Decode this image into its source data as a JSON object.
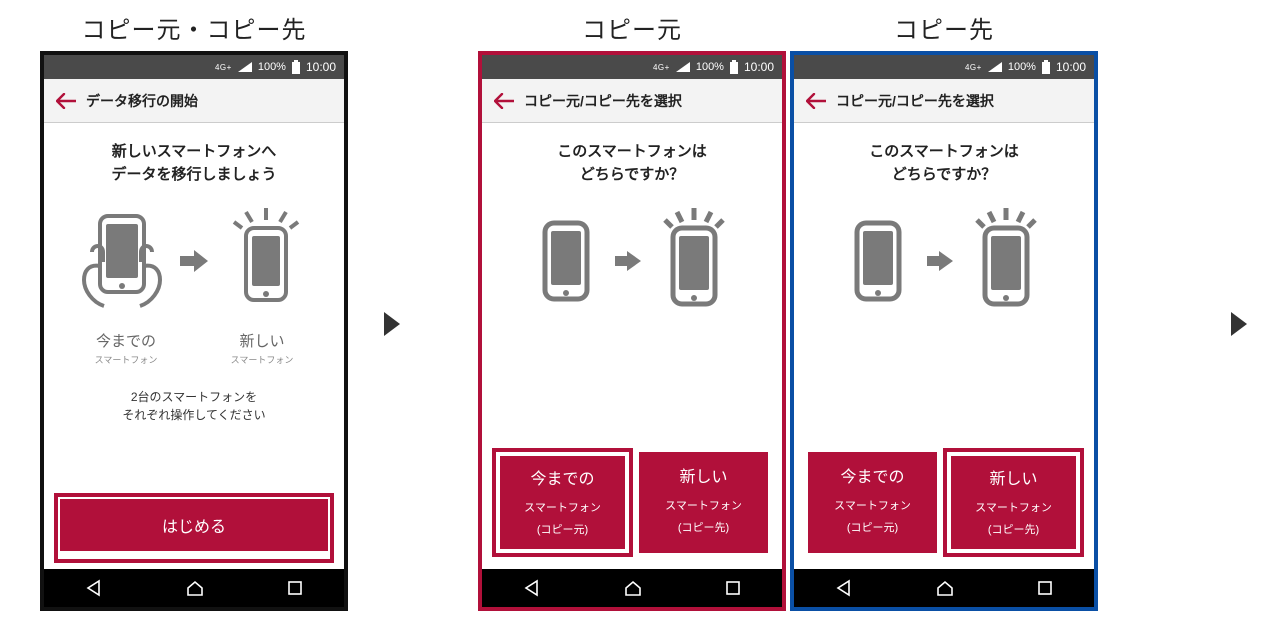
{
  "captions": {
    "both": "コピー元・コピー先",
    "src": "コピー元",
    "dst": "コピー先"
  },
  "status": {
    "net": "4G+",
    "battery": "100%",
    "time": "10:00"
  },
  "screen1": {
    "header": "データ移行の開始",
    "lead": "新しいスマートフォンへ\nデータを移行しましょう",
    "old_l1": "今までの",
    "old_l2": "スマートフォン",
    "new_l1": "新しい",
    "new_l2": "スマートフォン",
    "note": "2台のスマートフォンを\nそれぞれ操作してください",
    "start": "はじめる"
  },
  "screen2": {
    "header": "コピー元/コピー先を選択",
    "lead": "このスマートフォンは\nどちらですか？",
    "choice_old": {
      "l1": "今までの",
      "l2": "スマートフォン",
      "l3": "(コピー元)"
    },
    "choice_new": {
      "l1": "新しい",
      "l2": "スマートフォン",
      "l3": "(コピー先)"
    }
  },
  "colors": {
    "accent": "#b1103a",
    "frame_red": "#b1103a",
    "frame_blue": "#0a4fa5"
  }
}
